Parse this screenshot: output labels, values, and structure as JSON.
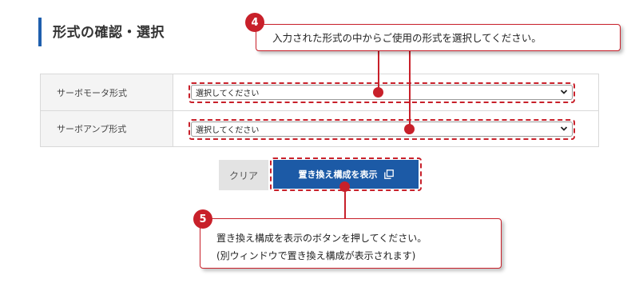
{
  "section": {
    "title": "形式の確認・選択"
  },
  "form": {
    "rows": [
      {
        "label": "サーボモータ形式",
        "select_value": "選択してください"
      },
      {
        "label": "サーボアンプ形式",
        "select_value": "選択してください"
      }
    ]
  },
  "buttons": {
    "clear_label": "クリア",
    "show_label": "置き換え構成を表示"
  },
  "callouts": {
    "step4": {
      "number": "4",
      "text": "入力された形式の中からご使用の形式を選択してください。"
    },
    "step5": {
      "number": "5",
      "line1": "置き換え構成を表示のボタンを押してください。",
      "line2": "(別ウィンドウで置き換え構成が表示されます)"
    }
  },
  "colors": {
    "accent": "#1f5fae",
    "highlight": "#c8202a",
    "button": "#1c5aa6"
  }
}
